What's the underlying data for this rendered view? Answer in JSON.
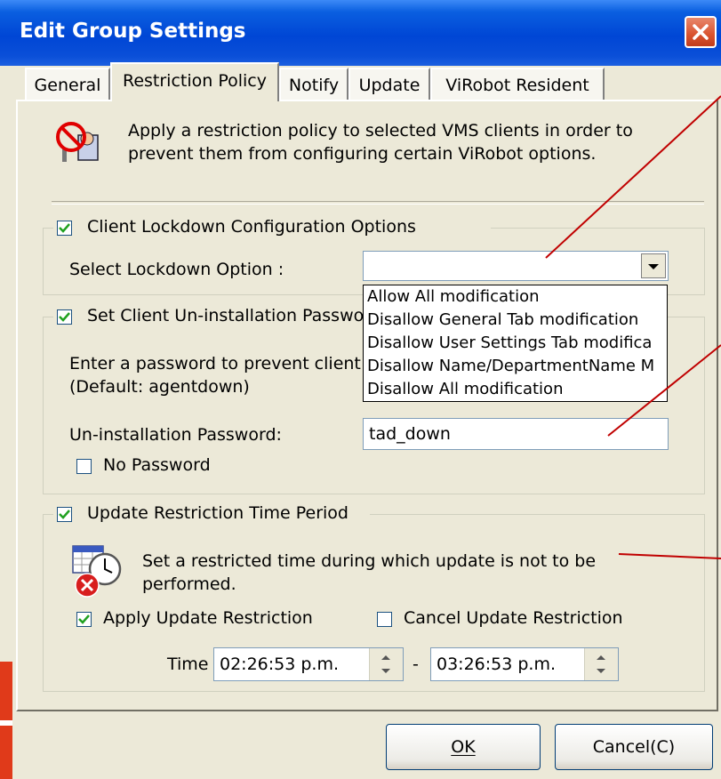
{
  "window": {
    "title": "Edit Group Settings"
  },
  "tabs": [
    {
      "label": "General"
    },
    {
      "label": "Restriction Policy"
    },
    {
      "label": "Notify"
    },
    {
      "label": "Update"
    },
    {
      "label": "ViRobot Resident"
    }
  ],
  "intro": {
    "line1": "Apply a restriction policy to selected VMS clients in order to",
    "line2": "prevent them from configuring certain ViRobot options."
  },
  "lockdown": {
    "title": "Client Lockdown Configuration Options",
    "checked": true,
    "select_label": "Select Lockdown Option :",
    "select_value": "",
    "options": [
      "Allow All modification",
      "Disallow General Tab modification",
      "Disallow User Settings Tab modifica",
      "Disallow Name/DepartmentName M",
      "Disallow All modification"
    ]
  },
  "uninstall": {
    "title": "Set Client Un-installation Passwo",
    "checked": true,
    "desc1": "Enter a password to prevent client",
    "desc2": "(Default:  agentdown)",
    "password_label": "Un-installation Password:",
    "password_value": "tad_down",
    "no_password_label": "No Password",
    "no_password_checked": false
  },
  "update_restriction": {
    "title": "Update Restriction Time Period",
    "checked": true,
    "desc1": "Set a restricted time during which update is not to be",
    "desc2": "performed.",
    "apply_label": "Apply Update Restriction",
    "apply_checked": true,
    "cancel_label": "Cancel Update Restriction",
    "cancel_checked": false,
    "time_label": "Time :",
    "time_start": "02:26:53 p.m.",
    "time_separator": "-",
    "time_end": "03:26:53 p.m."
  },
  "buttons": {
    "ok": "OK",
    "cancel": "Cancel(C)"
  },
  "colors": {
    "titlebar": "#0046d5",
    "annotation_line": "#c00000",
    "close": "#d9532f"
  }
}
